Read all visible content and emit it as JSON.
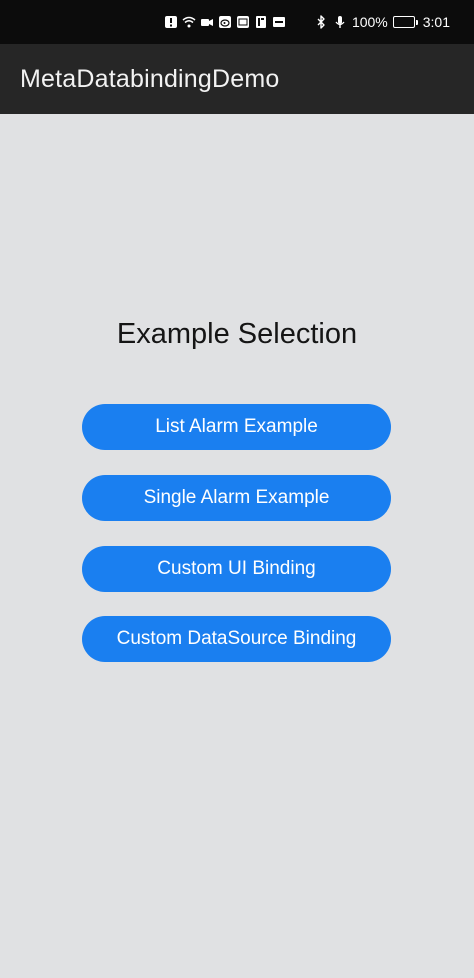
{
  "status_bar": {
    "battery_percent": "100%",
    "time": "3:01",
    "left_icons": [
      "alert-icon",
      "wifi-icon",
      "video-icon",
      "weibo-icon",
      "app-icon",
      "book-icon",
      "mpg-icon"
    ],
    "right_icons": [
      "bluetooth-icon",
      "microphone-icon",
      "battery-icon"
    ]
  },
  "app_bar": {
    "title": "MetaDatabindingDemo",
    "background": "#262626"
  },
  "main": {
    "heading": "Example Selection",
    "buttons": [
      {
        "label": "List Alarm Example"
      },
      {
        "label": "Single Alarm Example"
      },
      {
        "label": "Custom UI Binding"
      },
      {
        "label": "Custom DataSource Binding"
      }
    ],
    "button_color": "#1a7ff0",
    "background": "#e0e1e3"
  }
}
